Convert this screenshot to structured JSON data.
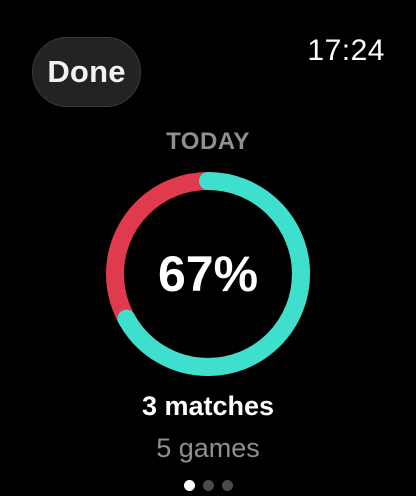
{
  "header": {
    "done_label": "Done",
    "time": "17:24"
  },
  "summary": {
    "period_label": "TODAY",
    "percent_label": "67%",
    "percent_value": 0.67,
    "matches_label": "3 matches",
    "games_label": "5 games"
  },
  "ring": {
    "accent_color": "#3fdfcd",
    "remainder_color": "#e03a4e"
  },
  "pager": {
    "page_count": 3,
    "active_page": 1
  }
}
